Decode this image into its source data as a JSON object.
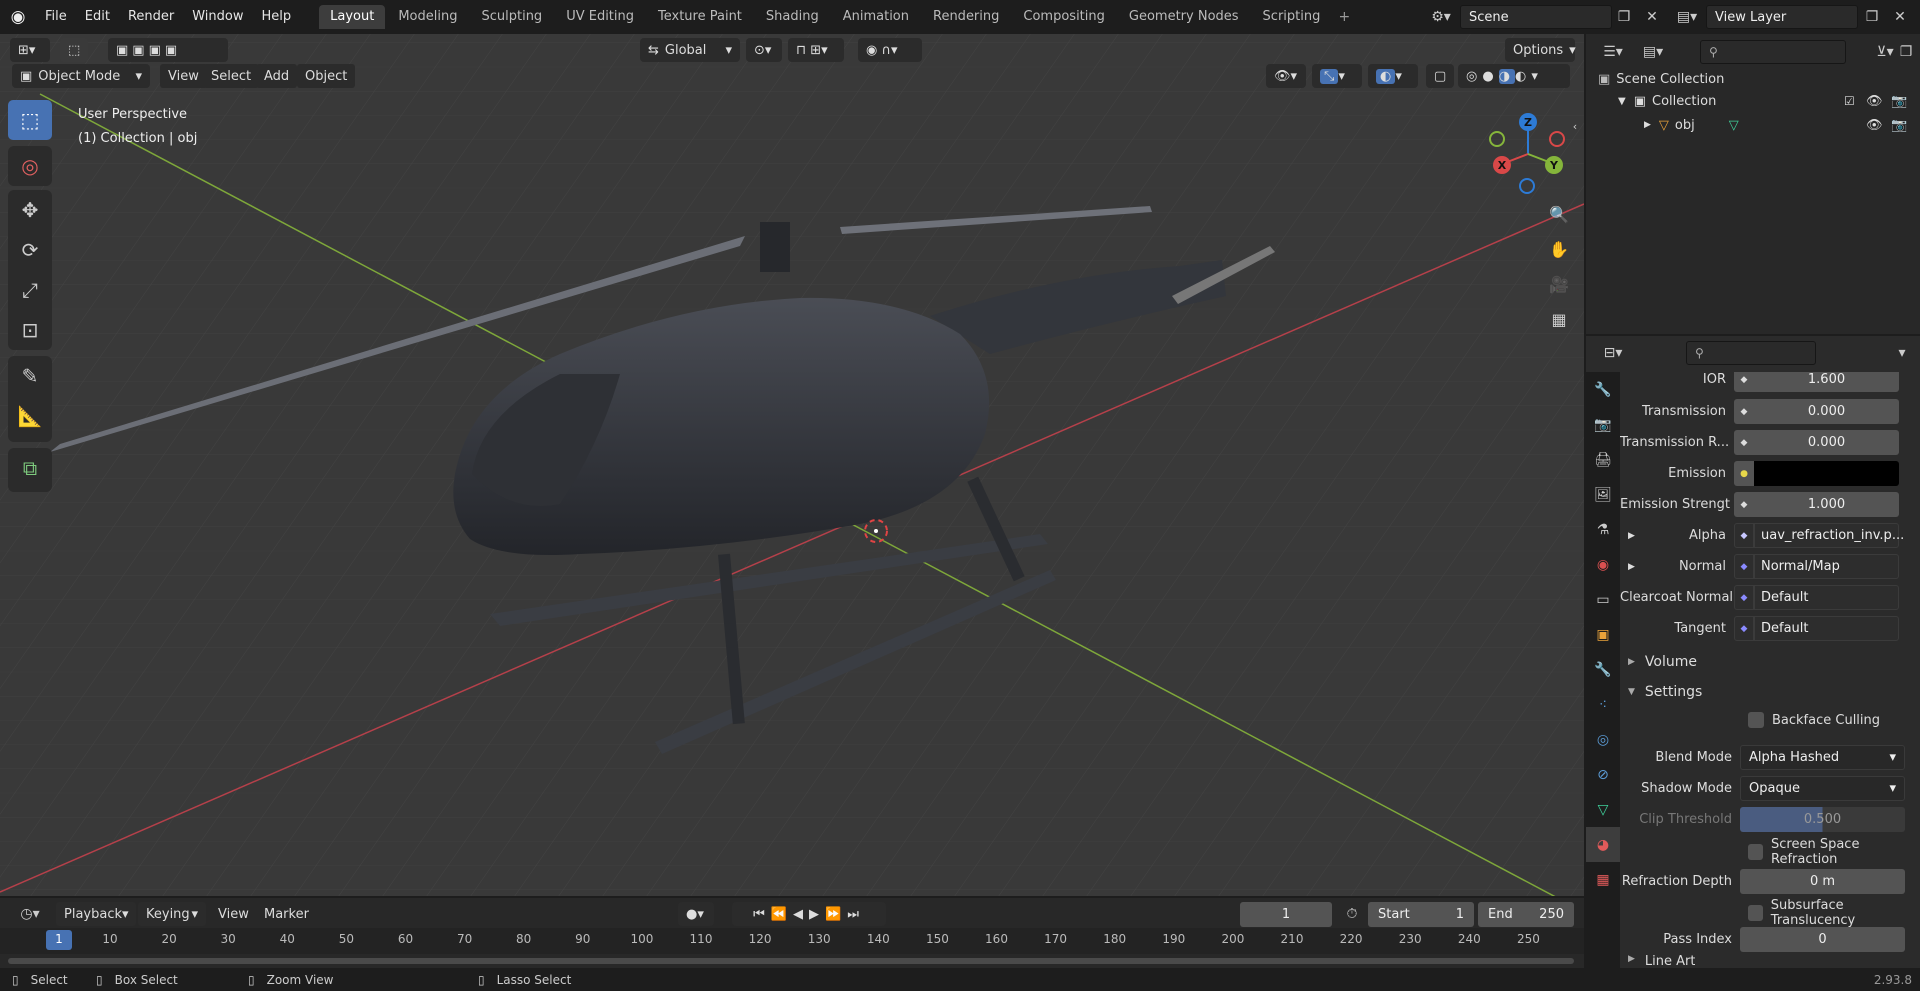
{
  "app_menu": [
    "File",
    "Edit",
    "Render",
    "Window",
    "Help"
  ],
  "workspaces": [
    "Layout",
    "Modeling",
    "Sculpting",
    "UV Editing",
    "Texture Paint",
    "Shading",
    "Animation",
    "Rendering",
    "Compositing",
    "Geometry Nodes",
    "Scripting"
  ],
  "active_workspace": "Layout",
  "scene": {
    "name": "Scene",
    "view_layer": "View Layer"
  },
  "viewport": {
    "transform_orientation": "Global",
    "options_label": "Options",
    "mode": "Object Mode",
    "menu": [
      "View",
      "Select",
      "Add",
      "Object"
    ],
    "info_line1": "User Perspective",
    "info_line2": "(1) Collection | obj",
    "gizmo": {
      "x": "X",
      "y": "Y",
      "z": "Z"
    }
  },
  "outliner": {
    "root": "Scene Collection",
    "collection": "Collection",
    "object": "obj"
  },
  "properties": {
    "rows": [
      {
        "label": "IOR",
        "value": "1.600",
        "type": "num"
      },
      {
        "label": "Transmission",
        "value": "0.000",
        "type": "num"
      },
      {
        "label": "Transmission R...",
        "value": "0.000",
        "type": "num"
      },
      {
        "label": "Emission",
        "value": "",
        "type": "color"
      },
      {
        "label": "Emission Strengt",
        "value": "1.000",
        "type": "num"
      },
      {
        "label": "Alpha",
        "value": "uav_refraction_inv.p...",
        "type": "link",
        "expand": true
      },
      {
        "label": "Normal",
        "value": "Normal/Map",
        "type": "link",
        "expand": true
      },
      {
        "label": "Clearcoat Normal",
        "value": "Default",
        "type": "link"
      },
      {
        "label": "Tangent",
        "value": "Default",
        "type": "link"
      }
    ],
    "section_volume": "Volume",
    "section_settings": "Settings",
    "backface_culling": "Backface Culling",
    "blend_mode_label": "Blend Mode",
    "blend_mode": "Alpha Hashed",
    "shadow_mode_label": "Shadow Mode",
    "shadow_mode": "Opaque",
    "clip_threshold_label": "Clip Threshold",
    "clip_threshold": "0.500",
    "ssr": "Screen Space Refraction",
    "refraction_depth_label": "Refraction Depth",
    "refraction_depth": "0 m",
    "subsurface": "Subsurface Translucency",
    "pass_index_label": "Pass Index",
    "pass_index": "0",
    "line_art": "Line Art"
  },
  "timeline": {
    "menu": [
      "Playback",
      "Keying",
      "View",
      "Marker"
    ],
    "current_frame": "1",
    "start_label": "Start",
    "start": "1",
    "end_label": "End",
    "end": "250",
    "ticks": [
      "1",
      "10",
      "20",
      "30",
      "40",
      "50",
      "60",
      "70",
      "80",
      "90",
      "100",
      "110",
      "120",
      "130",
      "140",
      "150",
      "160",
      "170",
      "180",
      "190",
      "200",
      "210",
      "220",
      "230",
      "240",
      "250"
    ]
  },
  "statusbar": {
    "select": "Select",
    "box_select": "Box Select",
    "zoom_view": "Zoom View",
    "lasso_select": "Lasso Select",
    "version": "2.93.8"
  },
  "colors": {
    "accent": "#4772b3",
    "x_axis": "#d94848",
    "y_axis": "#85b53b",
    "z_axis": "#2d7bd6"
  }
}
